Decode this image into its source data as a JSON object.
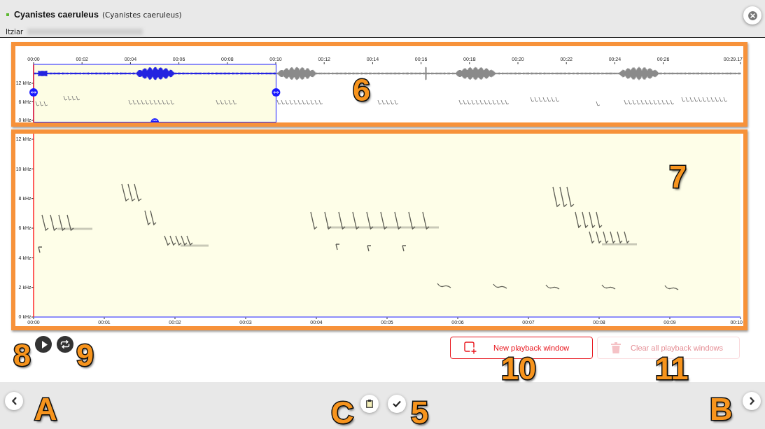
{
  "header": {
    "title": "Cyanistes caeruleus",
    "subtitle": "(Cyanistes caeruleus)",
    "recordist": "Itziar"
  },
  "overview": {
    "callout": "6",
    "time_ticks": [
      "00:00",
      "00:02",
      "00:04",
      "00:06",
      "00:08",
      "00:10",
      "00:12",
      "00:14",
      "00:16",
      "00:18",
      "00:20",
      "00:22",
      "00:24",
      "00:26",
      "00:29.17"
    ],
    "freq_labels": [
      "12 kHz",
      "6 kHz",
      "0 kHz"
    ],
    "selection": {
      "level": 0.343
    }
  },
  "main_view": {
    "callout": "7",
    "freq_labels": [
      "12 kHz",
      "10 kHz",
      "8 kHz",
      "6 kHz",
      "4 kHz",
      "2 kHz",
      "0 kHz"
    ],
    "time_ticks": [
      "00:00",
      "00:01",
      "00:02",
      "00:03",
      "00:04",
      "00:05",
      "00:06",
      "00:07",
      "00:08",
      "00:09",
      "00:10"
    ]
  },
  "playback_controls": [
    {
      "kind": "play",
      "callout": "8"
    },
    {
      "kind": "loop",
      "callout": "9"
    }
  ],
  "window_buttons": [
    {
      "kind": "new",
      "label": "New playback window",
      "disabled": false,
      "callout": "10"
    },
    {
      "kind": "clear",
      "label": "Clear all playback windows",
      "disabled": true,
      "callout": "11"
    }
  ],
  "footer": {
    "previous": {
      "callout": "A"
    },
    "actions": [
      {
        "kind": "notes",
        "callout": "C"
      },
      {
        "kind": "confirm",
        "callout": "5"
      }
    ],
    "next": {
      "callout": "B"
    }
  }
}
